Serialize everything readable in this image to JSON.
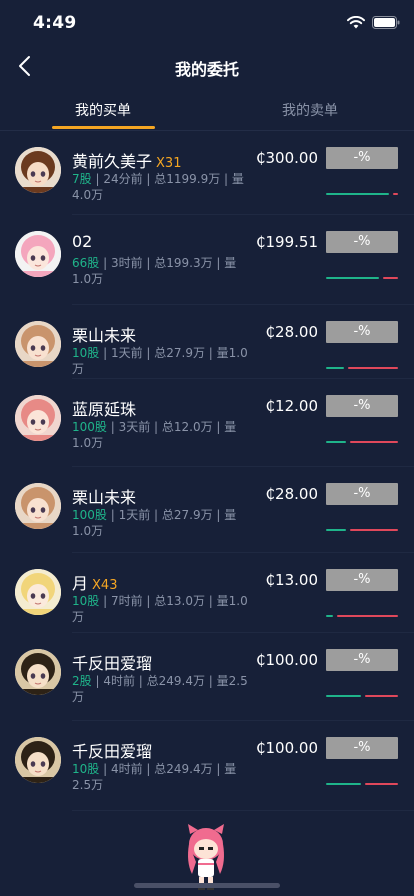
{
  "status": {
    "time": "4:49"
  },
  "nav": {
    "title": "我的委托"
  },
  "tabs": [
    {
      "label": "我的买单",
      "active": true
    },
    {
      "label": "我的卖单",
      "active": false
    }
  ],
  "colors": {
    "background": "#172038",
    "accent": "#f5a623",
    "green": "#1fb48a",
    "red": "#e0485b",
    "button_gray": "#9d9d9d"
  },
  "orders": [
    {
      "name": "黄前久美子",
      "multiplier": "X31",
      "qty": "7股",
      "detail": " | 24分前 | 总1199.9万 | 量4.0万",
      "price": "₵300.00",
      "pct": "-%",
      "green_ratio": 0.92
    },
    {
      "name": "02",
      "multiplier": "",
      "qty": "66股",
      "detail": " | 3时前 | 总199.3万 | 量1.0万",
      "price": "₵199.51",
      "pct": "-%",
      "green_ratio": 0.78
    },
    {
      "name": "栗山未来",
      "multiplier": "",
      "qty": "10股",
      "detail": " | 1天前 | 总27.9万 | 量1.0万",
      "price": "₵28.00",
      "pct": "-%",
      "green_ratio": 0.27
    },
    {
      "name": "蓝原延珠",
      "multiplier": "",
      "qty": "100股",
      "detail": " | 3天前 | 总12.0万 | 量1.0万",
      "price": "₵12.00",
      "pct": "-%",
      "green_ratio": 0.3
    },
    {
      "name": "栗山未来",
      "multiplier": "",
      "qty": "100股",
      "detail": " | 1天前 | 总27.9万 | 量1.0万",
      "price": "₵28.00",
      "pct": "-%",
      "green_ratio": 0.3
    },
    {
      "name": "月",
      "multiplier": "X43",
      "qty": "10股",
      "detail": " | 7时前 | 总13.0万 | 量1.0万",
      "price": "₵13.00",
      "pct": "-%",
      "green_ratio": 0.1
    },
    {
      "name": "千反田爱瑠",
      "multiplier": "",
      "qty": "2股",
      "detail": " | 4时前 | 总249.4万 | 量2.5万",
      "price": "₵100.00",
      "pct": "-%",
      "green_ratio": 0.52
    },
    {
      "name": "千反田爱瑠",
      "multiplier": "",
      "qty": "10股",
      "detail": " | 4时前 | 总249.4万 | 量2.5万",
      "price": "₵100.00",
      "pct": "-%",
      "green_ratio": 0.52
    }
  ]
}
